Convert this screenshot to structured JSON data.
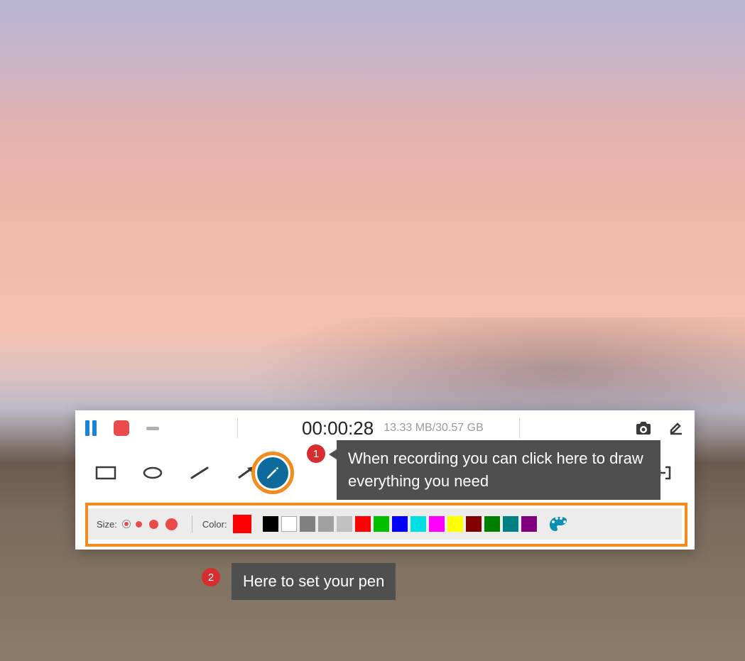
{
  "recorder": {
    "timer": "00:00:28",
    "file_size": "13.33 MB/30.57 GB"
  },
  "pen_settings": {
    "size_label": "Size:",
    "color_label": "Color:",
    "sizes": [
      6,
      9,
      13,
      17
    ],
    "selected_size_index": 0,
    "current_color": "#ff0000",
    "swatches": [
      "#000000",
      "#ffffff",
      "#808080",
      "#a0a0a0",
      "#c0c0c0",
      "#ff0000",
      "#00c000",
      "#0000ff",
      "#00e0e0",
      "#ff00ff",
      "#ffff00",
      "#800000",
      "#008000",
      "#008080",
      "#800080"
    ]
  },
  "callouts": {
    "badge1": "1",
    "text1": "When recording you can click here to draw everything you need",
    "badge2": "2",
    "text2": "Here to set your pen"
  }
}
